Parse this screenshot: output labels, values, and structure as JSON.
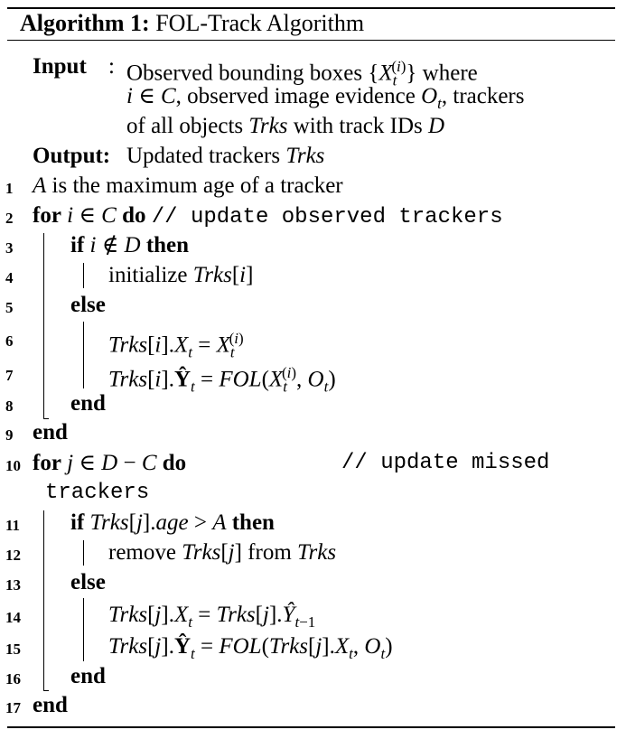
{
  "caption": {
    "label": "Algorithm 1:",
    "title": "FOL-Track Algorithm"
  },
  "input": {
    "label": "Input",
    "sep": ":",
    "lines": [
      "Observed bounding boxes {X_t^(i)} where",
      "i ∈ C, observed image evidence O_t, trackers",
      "of all objects Trks with track IDs D"
    ]
  },
  "output": {
    "label": "Output:",
    "text": "Updated trackers Trks"
  },
  "lines": [
    {
      "no": "1",
      "text": "A is the maximum age of a tracker"
    },
    {
      "no": "2",
      "kw1": "for",
      "cond": "i ∈ C",
      "kw2": "do",
      "comment": "// update observed trackers"
    },
    {
      "no": "3",
      "kw1": "if",
      "cond": "i ∉ D",
      "kw2": "then"
    },
    {
      "no": "4",
      "text": "initialize Trks[i]"
    },
    {
      "no": "5",
      "kw1": "else"
    },
    {
      "no": "6",
      "text": "Trks[i].X_t = X_t^(i)"
    },
    {
      "no": "7",
      "text": "Trks[i].Ŷ_t = FOL(X_t^(i), O_t)"
    },
    {
      "no": "8",
      "kw1": "end"
    },
    {
      "no": "9",
      "kw1": "end"
    },
    {
      "no": "10",
      "kw1": "for",
      "cond": "j ∈ D − C",
      "kw2": "do",
      "comment": "// update missed",
      "comment2": "trackers"
    },
    {
      "no": "11",
      "kw1": "if",
      "cond": "Trks[j].age > A",
      "kw2": "then"
    },
    {
      "no": "12",
      "text": "remove Trks[j] from Trks"
    },
    {
      "no": "13",
      "kw1": "else"
    },
    {
      "no": "14",
      "text": "Trks[j].X_t = Trks[j].Ŷ_t−1"
    },
    {
      "no": "15",
      "text": "Trks[j].Ŷ_t = FOL(Trks[j].X_t, O_t)"
    },
    {
      "no": "16",
      "kw1": "end"
    },
    {
      "no": "17",
      "kw1": "end"
    }
  ]
}
